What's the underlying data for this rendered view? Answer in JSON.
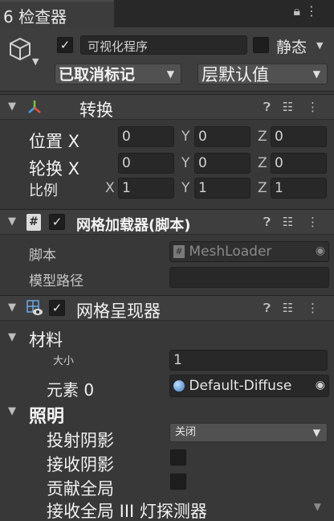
{
  "tab": {
    "title": "6 检查器",
    "lock_icon": "lock-icon",
    "menu_icon": "kebab-menu-icon"
  },
  "object": {
    "active": true,
    "name": "可视化程序",
    "static_label": "静态",
    "static_checked": false,
    "tag_label": "已取消标记",
    "layer_label": "层默认值"
  },
  "transform": {
    "title": "转换",
    "rows": [
      {
        "label": "位置 X",
        "x": "0",
        "y": "0",
        "z": "0"
      },
      {
        "label": "轮换 X",
        "x": "0",
        "y": "0",
        "z": "0"
      },
      {
        "label": "比例",
        "x": "1",
        "y": "1",
        "z": "1"
      }
    ],
    "axis_labels": {
      "x": "X",
      "y": "Y",
      "z": "Z"
    }
  },
  "mesh_loader": {
    "title": "网格加载器(脚本)",
    "enabled": true,
    "script_label": "脚本",
    "script_value": "MeshLoader",
    "path_label": "模型路径",
    "path_value": ""
  },
  "mesh_renderer": {
    "title": "网格呈现器",
    "enabled": true,
    "materials_label": "材料",
    "size_label": "大小",
    "size_value": "1",
    "element_label": "元素 0",
    "element_value": "Default-Diffuse",
    "lighting_label": "照明",
    "cast_shadows_label": "投射阴影",
    "cast_shadows_value": "关闭",
    "receive_shadows_label": "接收阴影",
    "contribute_gi_label": "贡献全局",
    "receive_gi_label": "接收全局 III 灯探测器"
  },
  "colors": {
    "background": "#383838",
    "header": "#3e3e3e",
    "field": "#282828",
    "accent_blue": "#4a9eda"
  }
}
